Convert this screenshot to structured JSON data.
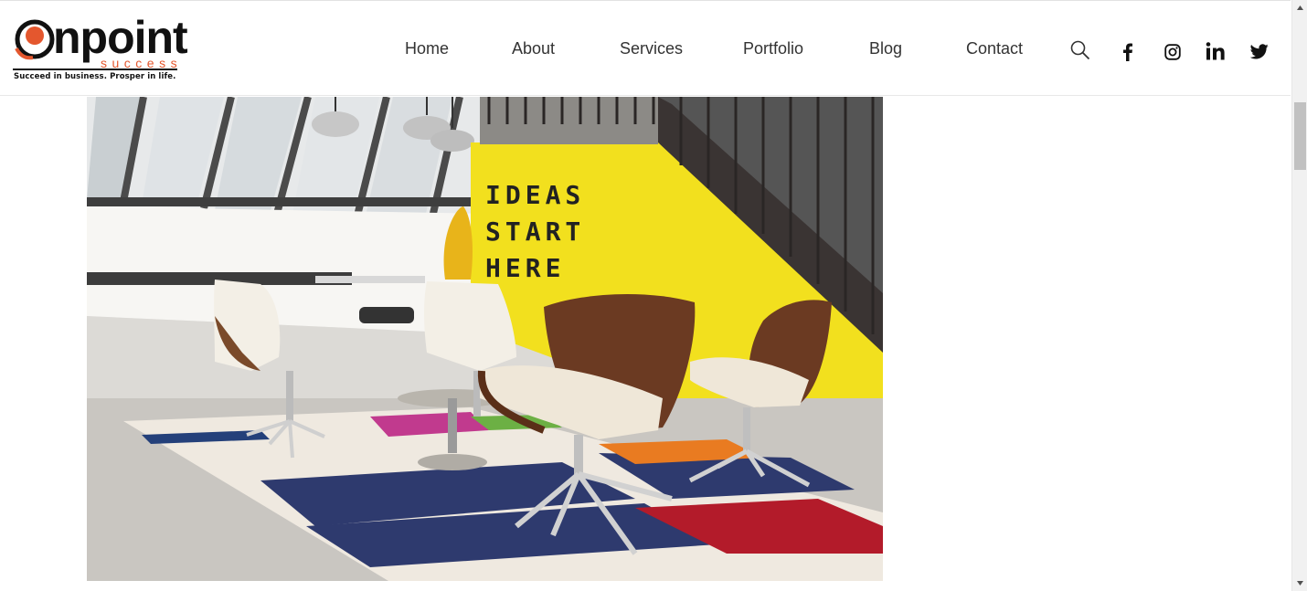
{
  "logo": {
    "word": "Onpoint",
    "sub": "success",
    "tagline": "Succeed in business. Prosper in life.",
    "accent_color": "#e4572e"
  },
  "nav": {
    "items": [
      {
        "label": "Home"
      },
      {
        "label": "About"
      },
      {
        "label": "Services"
      },
      {
        "label": "Portfolio"
      },
      {
        "label": "Blog"
      },
      {
        "label": "Contact"
      }
    ]
  },
  "header_icons": [
    "search-icon",
    "facebook-icon",
    "instagram-icon",
    "linkedin-icon",
    "twitter-icon"
  ],
  "hero": {
    "sign_lines": [
      "IDEAS",
      "START",
      "HERE"
    ],
    "wall_color": "#f2e01e"
  }
}
